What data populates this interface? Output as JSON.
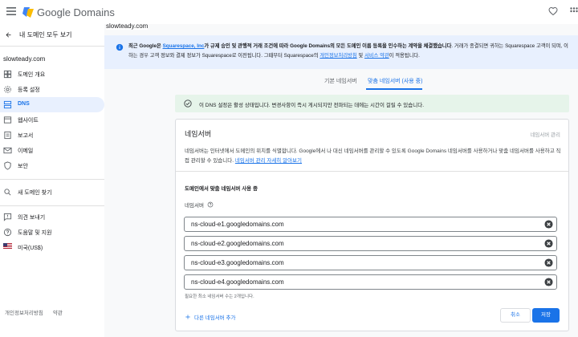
{
  "app": {
    "title": "Google Domains"
  },
  "sidebar": {
    "back_label": "내 도메인 모두 보기",
    "domain": "slowteady.com",
    "items": [
      {
        "label": "도메인 개요",
        "icon": "home-icon"
      },
      {
        "label": "등록 설정",
        "icon": "settings-icon"
      },
      {
        "label": "DNS",
        "icon": "dns-icon",
        "active": true
      },
      {
        "label": "웹사이트",
        "icon": "website-icon"
      },
      {
        "label": "보고서",
        "icon": "reports-icon"
      },
      {
        "label": "이메일",
        "icon": "email-icon"
      },
      {
        "label": "보안",
        "icon": "shield-icon"
      }
    ],
    "find_domain": "새 도메인 찾기",
    "footer_items": [
      {
        "label": "의견 보내기",
        "icon": "feedback-icon"
      },
      {
        "label": "도움말 및 지원",
        "icon": "help-icon"
      },
      {
        "label": "미국(US$)",
        "icon": "us-flag-icon"
      }
    ],
    "bottom_links": [
      "개인정보처리방침",
      "약관"
    ]
  },
  "main": {
    "domain_header": "slowteady.com",
    "info_banner": {
      "prefix": "최근 Google은 ",
      "link1": "Squarespace, Inc",
      "bold_rest": "가 규제 승인 및 관행적 거래 조건에 따라 Google Domains의 모든 도메인 이름 등록을 인수하는 계약을 체결했습니다",
      "text": ". 거래가 종결되면 귀하는 Squarespace 고객이 되며, 이",
      "line2": "하는 경우 고객 정보와 결제 정보가 Squarespace로 이전됩니다. 그때부터 Squarespace의 ",
      "link2": "개인정보처리방침",
      "mid": " 및 ",
      "link3": "서비스 약관",
      "end": "이 적용됩니다."
    },
    "tabs": [
      {
        "label": "기본 네임서버",
        "active": false
      },
      {
        "label": "맞춤 네임서버 (사용 중)",
        "active": true
      }
    ],
    "status": "이 DNS 설정은 활성 상태입니다. 변경사항이 즉시 게시되지만 전파되는 데에는 시간이 걸릴 수 있습니다.",
    "card": {
      "title": "네임서버",
      "manage": "네임서버 관리",
      "desc1": "네임서버는 인터넷에서 도메인의 위치를 식별합니다. Google에서 나 대신 네임서버를 관리할 수 있도록 Google Domains 네임서버를 사용하거나 맞춤 네임서버를 사용하고 직",
      "desc2": "접 관리할 수 있습니다. ",
      "desc_link": "네임서버 관리 자세히 알아보기",
      "custom_label": "도메인에서 맞춤 네임서버 사용 중",
      "ns_label": "네임서버",
      "nameservers": [
        "ns-cloud-e1.googledomains.com",
        "ns-cloud-e2.googledomains.com",
        "ns-cloud-e3.googledomains.com",
        "ns-cloud-e4.googledomains.com"
      ],
      "min_note": "필요한 최소 네임서버 수는 2개입니다.",
      "add_label": "다른 네임서버 추가",
      "cancel": "취소",
      "save": "저장"
    }
  },
  "colors": {
    "accent": "#1a73e8",
    "active_bg": "#e8f0fe",
    "success_bg": "#e6f4ea",
    "info_bg": "#e8f0fe"
  }
}
